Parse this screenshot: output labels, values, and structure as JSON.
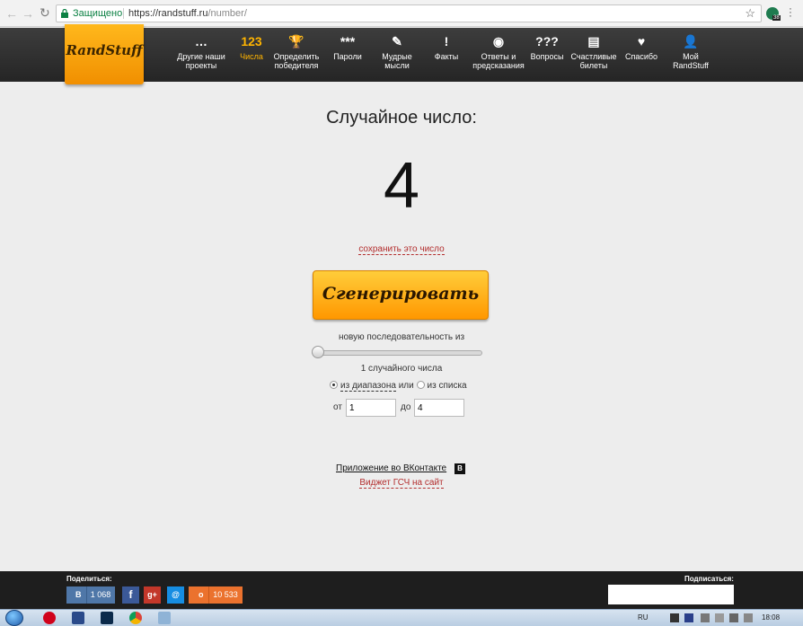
{
  "browser": {
    "secure_label": "Защищено",
    "url_host": "https://randstuff.ru",
    "url_path": "/number/",
    "extension_badge": "38"
  },
  "site": {
    "logo": "RandStuff",
    "nav": [
      {
        "icon": "…",
        "label1": "Другие наши",
        "label2": "проекты",
        "icon_name": "dots-icon"
      },
      {
        "icon": "123",
        "label1": "Числа",
        "label2": "",
        "icon_name": "numbers-icon",
        "active": true
      },
      {
        "icon": "🏆",
        "label1": "Определить",
        "label2": "победителя",
        "icon_name": "trophy-icon"
      },
      {
        "icon": "***",
        "label1": "Пароли",
        "label2": "",
        "icon_name": "password-icon"
      },
      {
        "icon": "✎",
        "label1": "Мудрые",
        "label2": "мысли",
        "icon_name": "quote-icon"
      },
      {
        "icon": "!",
        "label1": "Факты",
        "label2": "",
        "icon_name": "fact-icon"
      },
      {
        "icon": "◉",
        "label1": "Ответы и",
        "label2": "предсказания",
        "icon_name": "magic-ball-icon"
      },
      {
        "icon": "???",
        "label1": "Вопросы",
        "label2": "",
        "icon_name": "questions-icon"
      },
      {
        "icon": "▤",
        "label1": "Счастливые",
        "label2": "билеты",
        "icon_name": "tickets-icon"
      },
      {
        "icon": "♥",
        "label1": "Спасибо",
        "label2": "",
        "icon_name": "heart-icon"
      },
      {
        "icon": "👤",
        "label1": "Мой",
        "label2": "RandStuff",
        "icon_name": "user-icon"
      }
    ]
  },
  "main": {
    "heading": "Случайное число:",
    "number": "4",
    "save_link": "сохранить это число",
    "generate_button": "Сгенерировать",
    "sequence_label": "новую последовательность из",
    "count_label": "1 случайного числа",
    "radio_range": "из диапазона",
    "radio_or": "или",
    "radio_list": "из списка",
    "from_label": "от",
    "from_value": "1",
    "to_label": "до",
    "to_value": "4",
    "vk_app_link": "Приложение во ВКонтакте",
    "vk_badge": "В",
    "widget_link": "Виджет ГСЧ на сайт"
  },
  "footer": {
    "share_label": "Поделиться:",
    "subscribe_label": "Подписаться:",
    "vk_letter": "В",
    "vk_count": "1 068",
    "fb_letter": "f",
    "gp_letter": "g+",
    "mail_letter": "@",
    "ok_letter": "о",
    "ok_count": "10 533"
  },
  "taskbar": {
    "lang": "RU",
    "clock": "18:08"
  }
}
